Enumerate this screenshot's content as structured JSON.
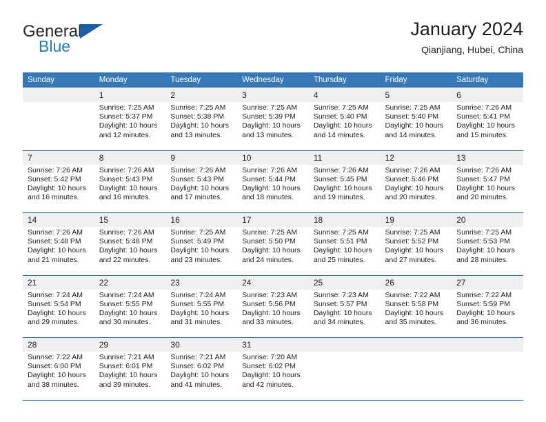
{
  "brand": {
    "word1": "General",
    "word2": "Blue",
    "triangle_icon": "triangle-logo-icon",
    "accent_color": "#1a5fa8",
    "blue_text_color": "#1d7dc4"
  },
  "header": {
    "title": "January 2024",
    "location": "Qianjiang, Hubei, China"
  },
  "theme": {
    "header_row_bg": "#3679b6",
    "daynum_bg": "#efefef",
    "week_divider": "#2f6eae"
  },
  "calendar": {
    "weekday_headers": [
      "Sunday",
      "Monday",
      "Tuesday",
      "Wednesday",
      "Thursday",
      "Friday",
      "Saturday"
    ],
    "weeks": [
      [
        {
          "day": "",
          "lines": []
        },
        {
          "day": "1",
          "lines": [
            "Sunrise: 7:25 AM",
            "Sunset: 5:37 PM",
            "Daylight: 10 hours",
            "and 12 minutes."
          ]
        },
        {
          "day": "2",
          "lines": [
            "Sunrise: 7:25 AM",
            "Sunset: 5:38 PM",
            "Daylight: 10 hours",
            "and 13 minutes."
          ]
        },
        {
          "day": "3",
          "lines": [
            "Sunrise: 7:25 AM",
            "Sunset: 5:39 PM",
            "Daylight: 10 hours",
            "and 13 minutes."
          ]
        },
        {
          "day": "4",
          "lines": [
            "Sunrise: 7:25 AM",
            "Sunset: 5:40 PM",
            "Daylight: 10 hours",
            "and 14 minutes."
          ]
        },
        {
          "day": "5",
          "lines": [
            "Sunrise: 7:25 AM",
            "Sunset: 5:40 PM",
            "Daylight: 10 hours",
            "and 14 minutes."
          ]
        },
        {
          "day": "6",
          "lines": [
            "Sunrise: 7:26 AM",
            "Sunset: 5:41 PM",
            "Daylight: 10 hours",
            "and 15 minutes."
          ]
        }
      ],
      [
        {
          "day": "7",
          "lines": [
            "Sunrise: 7:26 AM",
            "Sunset: 5:42 PM",
            "Daylight: 10 hours",
            "and 16 minutes."
          ]
        },
        {
          "day": "8",
          "lines": [
            "Sunrise: 7:26 AM",
            "Sunset: 5:43 PM",
            "Daylight: 10 hours",
            "and 16 minutes."
          ]
        },
        {
          "day": "9",
          "lines": [
            "Sunrise: 7:26 AM",
            "Sunset: 5:43 PM",
            "Daylight: 10 hours",
            "and 17 minutes."
          ]
        },
        {
          "day": "10",
          "lines": [
            "Sunrise: 7:26 AM",
            "Sunset: 5:44 PM",
            "Daylight: 10 hours",
            "and 18 minutes."
          ]
        },
        {
          "day": "11",
          "lines": [
            "Sunrise: 7:26 AM",
            "Sunset: 5:45 PM",
            "Daylight: 10 hours",
            "and 19 minutes."
          ]
        },
        {
          "day": "12",
          "lines": [
            "Sunrise: 7:26 AM",
            "Sunset: 5:46 PM",
            "Daylight: 10 hours",
            "and 20 minutes."
          ]
        },
        {
          "day": "13",
          "lines": [
            "Sunrise: 7:26 AM",
            "Sunset: 5:47 PM",
            "Daylight: 10 hours",
            "and 20 minutes."
          ]
        }
      ],
      [
        {
          "day": "14",
          "lines": [
            "Sunrise: 7:26 AM",
            "Sunset: 5:48 PM",
            "Daylight: 10 hours",
            "and 21 minutes."
          ]
        },
        {
          "day": "15",
          "lines": [
            "Sunrise: 7:26 AM",
            "Sunset: 5:48 PM",
            "Daylight: 10 hours",
            "and 22 minutes."
          ]
        },
        {
          "day": "16",
          "lines": [
            "Sunrise: 7:25 AM",
            "Sunset: 5:49 PM",
            "Daylight: 10 hours",
            "and 23 minutes."
          ]
        },
        {
          "day": "17",
          "lines": [
            "Sunrise: 7:25 AM",
            "Sunset: 5:50 PM",
            "Daylight: 10 hours",
            "and 24 minutes."
          ]
        },
        {
          "day": "18",
          "lines": [
            "Sunrise: 7:25 AM",
            "Sunset: 5:51 PM",
            "Daylight: 10 hours",
            "and 25 minutes."
          ]
        },
        {
          "day": "19",
          "lines": [
            "Sunrise: 7:25 AM",
            "Sunset: 5:52 PM",
            "Daylight: 10 hours",
            "and 27 minutes."
          ]
        },
        {
          "day": "20",
          "lines": [
            "Sunrise: 7:25 AM",
            "Sunset: 5:53 PM",
            "Daylight: 10 hours",
            "and 28 minutes."
          ]
        }
      ],
      [
        {
          "day": "21",
          "lines": [
            "Sunrise: 7:24 AM",
            "Sunset: 5:54 PM",
            "Daylight: 10 hours",
            "and 29 minutes."
          ]
        },
        {
          "day": "22",
          "lines": [
            "Sunrise: 7:24 AM",
            "Sunset: 5:55 PM",
            "Daylight: 10 hours",
            "and 30 minutes."
          ]
        },
        {
          "day": "23",
          "lines": [
            "Sunrise: 7:24 AM",
            "Sunset: 5:55 PM",
            "Daylight: 10 hours",
            "and 31 minutes."
          ]
        },
        {
          "day": "24",
          "lines": [
            "Sunrise: 7:23 AM",
            "Sunset: 5:56 PM",
            "Daylight: 10 hours",
            "and 33 minutes."
          ]
        },
        {
          "day": "25",
          "lines": [
            "Sunrise: 7:23 AM",
            "Sunset: 5:57 PM",
            "Daylight: 10 hours",
            "and 34 minutes."
          ]
        },
        {
          "day": "26",
          "lines": [
            "Sunrise: 7:22 AM",
            "Sunset: 5:58 PM",
            "Daylight: 10 hours",
            "and 35 minutes."
          ]
        },
        {
          "day": "27",
          "lines": [
            "Sunrise: 7:22 AM",
            "Sunset: 5:59 PM",
            "Daylight: 10 hours",
            "and 36 minutes."
          ]
        }
      ],
      [
        {
          "day": "28",
          "lines": [
            "Sunrise: 7:22 AM",
            "Sunset: 6:00 PM",
            "Daylight: 10 hours",
            "and 38 minutes."
          ]
        },
        {
          "day": "29",
          "lines": [
            "Sunrise: 7:21 AM",
            "Sunset: 6:01 PM",
            "Daylight: 10 hours",
            "and 39 minutes."
          ]
        },
        {
          "day": "30",
          "lines": [
            "Sunrise: 7:21 AM",
            "Sunset: 6:02 PM",
            "Daylight: 10 hours",
            "and 41 minutes."
          ]
        },
        {
          "day": "31",
          "lines": [
            "Sunrise: 7:20 AM",
            "Sunset: 6:02 PM",
            "Daylight: 10 hours",
            "and 42 minutes."
          ]
        },
        {
          "day": "",
          "lines": []
        },
        {
          "day": "",
          "lines": []
        },
        {
          "day": "",
          "lines": []
        }
      ]
    ]
  }
}
